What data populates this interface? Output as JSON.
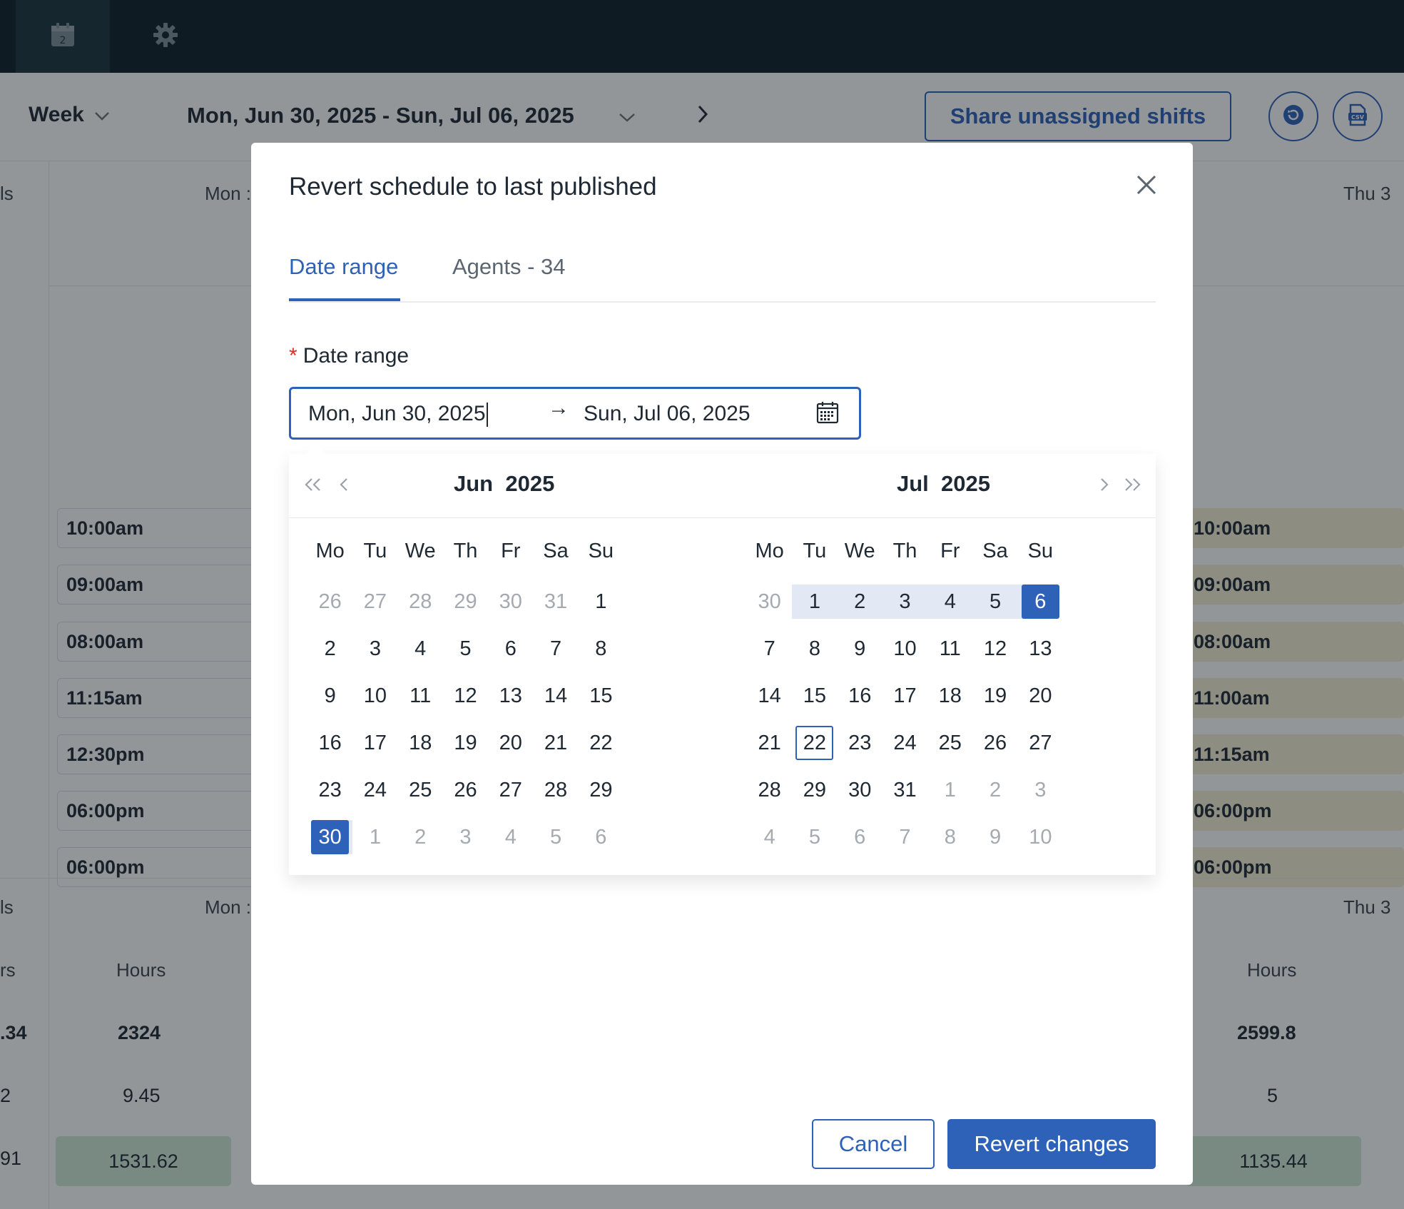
{
  "nav": {
    "items": [
      {
        "name": "schedule",
        "icon": "calendar-icon",
        "active": true
      },
      {
        "name": "settings",
        "icon": "gear-icon",
        "active": false
      }
    ]
  },
  "toolbar": {
    "view": "Week",
    "range": "Mon, Jun 30, 2025 - Sun, Jul 06, 2025",
    "share_label": "Share unassigned shifts",
    "revert_icon": "revert-icon",
    "csv_icon": "csv-export-icon"
  },
  "schedule": {
    "left_col_fragment": "ls",
    "mon_header": "Mon :",
    "thu_header": "Thu 3",
    "left_shifts": [
      "10:00am",
      "09:00am",
      "08:00am",
      "11:15am",
      "12:30pm",
      "06:00pm",
      "06:00pm"
    ],
    "right_shifts": [
      "10:00am",
      "09:00am",
      "08:00am",
      "11:00am",
      "11:15am",
      "06:00pm",
      "06:00pm"
    ],
    "stats": {
      "left_fragment_labels": [
        "ls",
        "rs"
      ],
      "hours_label": "Hours",
      "left_fragments": [
        ".34",
        "2",
        "91"
      ],
      "mon": {
        "total": "2324",
        "avg": "9.45",
        "cost": "1531.62"
      },
      "thu": {
        "total": "2599.8",
        "avg": "5",
        "cost": "1135.44"
      }
    }
  },
  "modal": {
    "title": "Revert schedule to last published",
    "tabs": [
      {
        "label": "Date range",
        "active": true
      },
      {
        "label": "Agents - 34",
        "active": false
      }
    ],
    "field_label": "Date range",
    "required_mark": "*",
    "start_value": "Mon, Jun 30, 2025",
    "end_value": "Sun, Jul 06, 2025",
    "separator": "→",
    "cancel_label": "Cancel",
    "confirm_label": "Revert changes"
  },
  "calendar": {
    "weekdays": [
      "Mo",
      "Tu",
      "We",
      "Th",
      "Fr",
      "Sa",
      "Su"
    ],
    "months": [
      {
        "title_month": "Jun",
        "title_year": "2025",
        "weeks": [
          [
            {
              "d": "26",
              "m": 1
            },
            {
              "d": "27",
              "m": 1
            },
            {
              "d": "28",
              "m": 1
            },
            {
              "d": "29",
              "m": 1
            },
            {
              "d": "30",
              "m": 1
            },
            {
              "d": "31",
              "m": 1
            },
            {
              "d": "1"
            }
          ],
          [
            {
              "d": "2"
            },
            {
              "d": "3"
            },
            {
              "d": "4"
            },
            {
              "d": "5"
            },
            {
              "d": "6"
            },
            {
              "d": "7"
            },
            {
              "d": "8"
            }
          ],
          [
            {
              "d": "9"
            },
            {
              "d": "10"
            },
            {
              "d": "11"
            },
            {
              "d": "12"
            },
            {
              "d": "13"
            },
            {
              "d": "14"
            },
            {
              "d": "15"
            }
          ],
          [
            {
              "d": "16"
            },
            {
              "d": "17"
            },
            {
              "d": "18"
            },
            {
              "d": "19"
            },
            {
              "d": "20"
            },
            {
              "d": "21"
            },
            {
              "d": "22"
            }
          ],
          [
            {
              "d": "23"
            },
            {
              "d": "24"
            },
            {
              "d": "25"
            },
            {
              "d": "26"
            },
            {
              "d": "27"
            },
            {
              "d": "28"
            },
            {
              "d": "29"
            }
          ],
          [
            {
              "d": "30",
              "s": "start"
            },
            {
              "d": "1",
              "m": 1
            },
            {
              "d": "2",
              "m": 1
            },
            {
              "d": "3",
              "m": 1
            },
            {
              "d": "4",
              "m": 1
            },
            {
              "d": "5",
              "m": 1
            },
            {
              "d": "6",
              "m": 1
            }
          ]
        ]
      },
      {
        "title_month": "Jul",
        "title_year": "2025",
        "weeks": [
          [
            {
              "d": "30",
              "m": 1
            },
            {
              "d": "1",
              "s": "in"
            },
            {
              "d": "2",
              "s": "in"
            },
            {
              "d": "3",
              "s": "in"
            },
            {
              "d": "4",
              "s": "in"
            },
            {
              "d": "5",
              "s": "in"
            },
            {
              "d": "6",
              "s": "end"
            }
          ],
          [
            {
              "d": "7"
            },
            {
              "d": "8"
            },
            {
              "d": "9"
            },
            {
              "d": "10"
            },
            {
              "d": "11"
            },
            {
              "d": "12"
            },
            {
              "d": "13"
            }
          ],
          [
            {
              "d": "14"
            },
            {
              "d": "15"
            },
            {
              "d": "16"
            },
            {
              "d": "17"
            },
            {
              "d": "18"
            },
            {
              "d": "19"
            },
            {
              "d": "20"
            }
          ],
          [
            {
              "d": "21"
            },
            {
              "d": "22",
              "s": "today"
            },
            {
              "d": "23"
            },
            {
              "d": "24"
            },
            {
              "d": "25"
            },
            {
              "d": "26"
            },
            {
              "d": "27"
            }
          ],
          [
            {
              "d": "28"
            },
            {
              "d": "29"
            },
            {
              "d": "30"
            },
            {
              "d": "31"
            },
            {
              "d": "1",
              "m": 1
            },
            {
              "d": "2",
              "m": 1
            },
            {
              "d": "3",
              "m": 1
            }
          ],
          [
            {
              "d": "4",
              "m": 1
            },
            {
              "d": "5",
              "m": 1
            },
            {
              "d": "6",
              "m": 1
            },
            {
              "d": "7",
              "m": 1
            },
            {
              "d": "8",
              "m": 1
            },
            {
              "d": "9",
              "m": 1
            },
            {
              "d": "10",
              "m": 1
            }
          ]
        ]
      }
    ],
    "nav_icons": [
      "double-chevron-left-icon",
      "chevron-left-icon",
      "chevron-right-icon",
      "double-chevron-right-icon"
    ]
  },
  "colors": {
    "accent": "#2e62b8",
    "nav_bg": "#0f2029",
    "range_fill": "#e3e9f4",
    "required": "#d93025",
    "shift_yellow": "#f6efd3",
    "stat_green": "#cfe9d8"
  }
}
